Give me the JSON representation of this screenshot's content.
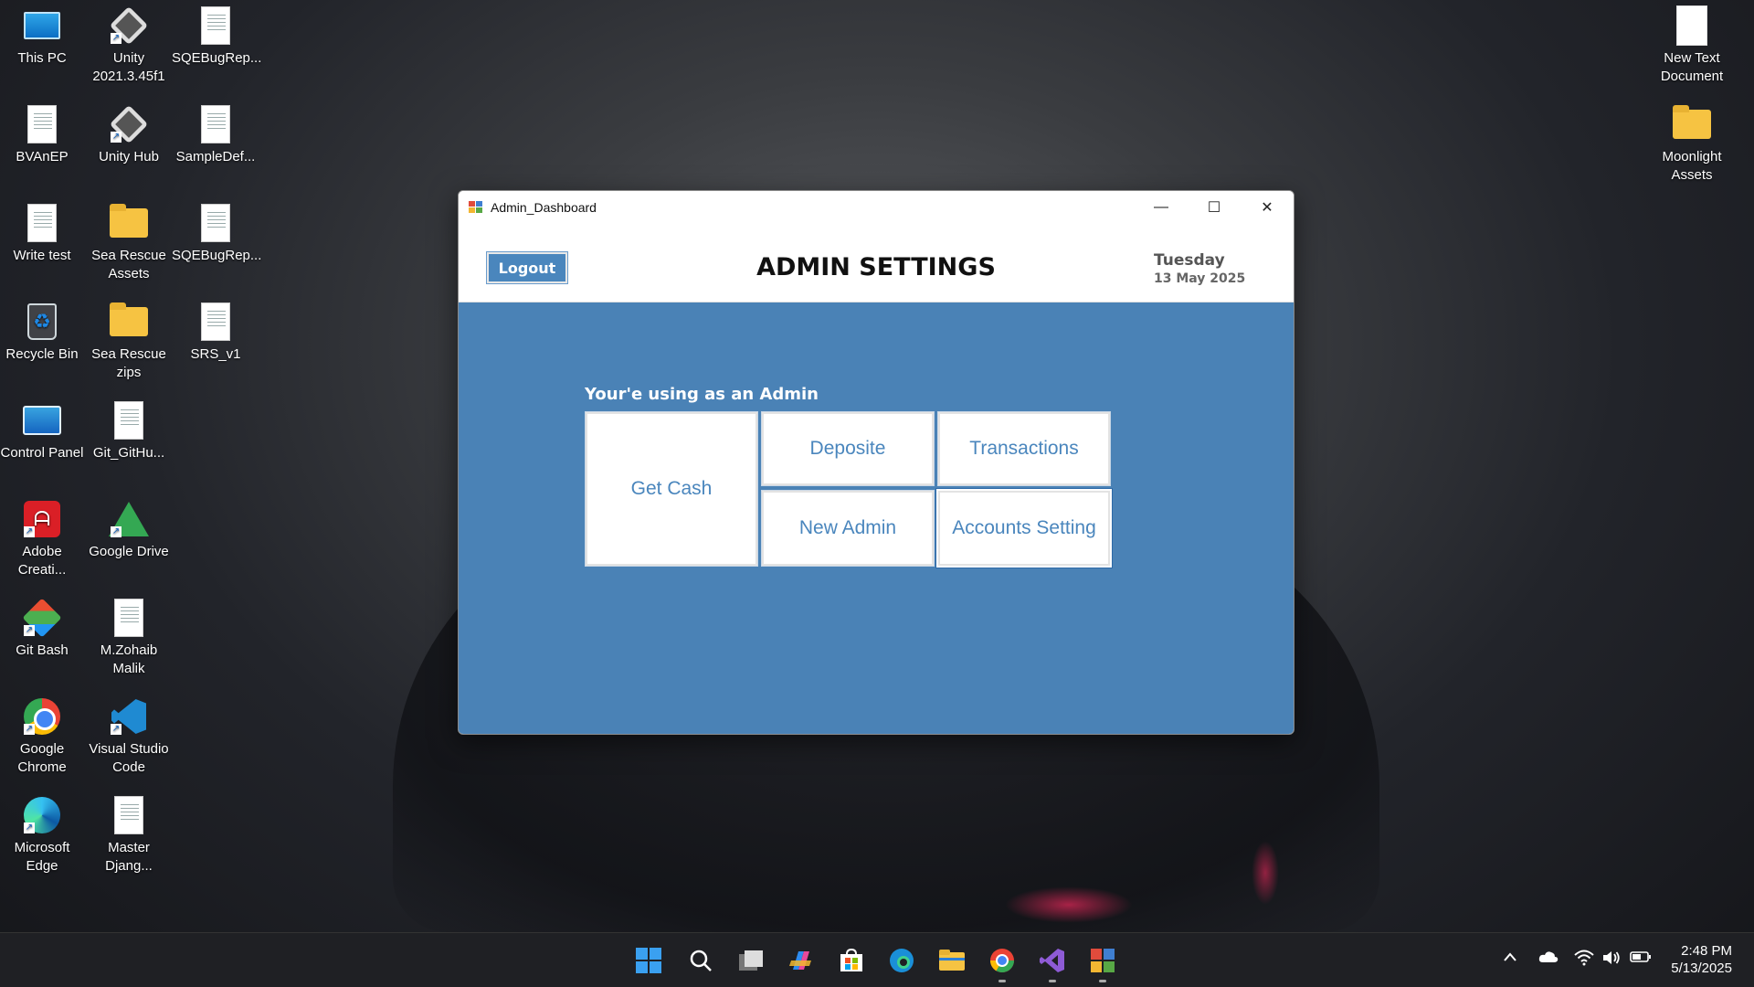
{
  "desktop": {
    "icons_left": [
      {
        "label": "This PC",
        "icon": "monitor-icon"
      },
      {
        "label": "Unity 2021.3.45f1",
        "icon": "unity-icon"
      },
      {
        "label": "SQEBugRep...",
        "icon": "document-icon"
      },
      {
        "label": "BVAnEP",
        "icon": "document-icon"
      },
      {
        "label": "Unity Hub",
        "icon": "unity-icon"
      },
      {
        "label": "SampleDef...",
        "icon": "document-icon"
      },
      {
        "label": "Write test",
        "icon": "document-icon"
      },
      {
        "label": "Sea Rescue Assets",
        "icon": "folder-icon"
      },
      {
        "label": "SQEBugRep...",
        "icon": "document-icon"
      },
      {
        "label": "Recycle Bin",
        "icon": "recycle-bin-icon"
      },
      {
        "label": "Sea Rescue zips",
        "icon": "folder-icon"
      },
      {
        "label": "SRS_v1",
        "icon": "document-icon"
      },
      {
        "label": "Control Panel",
        "icon": "control-panel-icon"
      },
      {
        "label": "Git_GitHu...",
        "icon": "document-icon"
      },
      {
        "label": "Adobe Creati...",
        "icon": "adobe-icon"
      },
      {
        "label": "Google Drive",
        "icon": "google-drive-icon"
      },
      {
        "label": "Git Bash",
        "icon": "git-bash-icon"
      },
      {
        "label": "M.Zohaib Malik",
        "icon": "document-icon"
      },
      {
        "label": "Google Chrome",
        "icon": "chrome-icon"
      },
      {
        "label": "Visual Studio Code",
        "icon": "vscode-icon"
      },
      {
        "label": "Microsoft Edge",
        "icon": "edge-icon"
      },
      {
        "label": "Master Djang...",
        "icon": "document-icon"
      }
    ],
    "icons_right": [
      {
        "label": "New Text Document",
        "icon": "text-document-icon"
      },
      {
        "label": "Moonlight Assets",
        "icon": "folder-icon"
      }
    ]
  },
  "window": {
    "title": "Admin_Dashboard",
    "controls": {
      "minimize": "—",
      "maximize": "☐",
      "close": "✕"
    }
  },
  "header": {
    "logout_label": "Logout",
    "page_title": "ADMIN SETTINGS",
    "day": "Tuesday",
    "date": "13 May 2025"
  },
  "main": {
    "subtitle": "Your'e using as an Admin",
    "tiles": {
      "get_cash": "Get Cash",
      "deposite": "Deposite",
      "transactions": "Transactions",
      "new_admin": "New Admin",
      "accounts_setting": "Accounts Setting"
    }
  },
  "taskbar": {
    "apps": [
      "start-icon",
      "search-icon",
      "task-view-icon",
      "copilot-icon",
      "store-icon",
      "edge-icon",
      "file-explorer-icon",
      "chrome-icon",
      "visual-studio-icon",
      "winforms-app-icon"
    ],
    "time": "2:48 PM",
    "date": "5/13/2025"
  },
  "colors": {
    "panel_blue": "#4a82b6",
    "button_blue": "#4a86bd",
    "taskbar": "#1f2024"
  }
}
